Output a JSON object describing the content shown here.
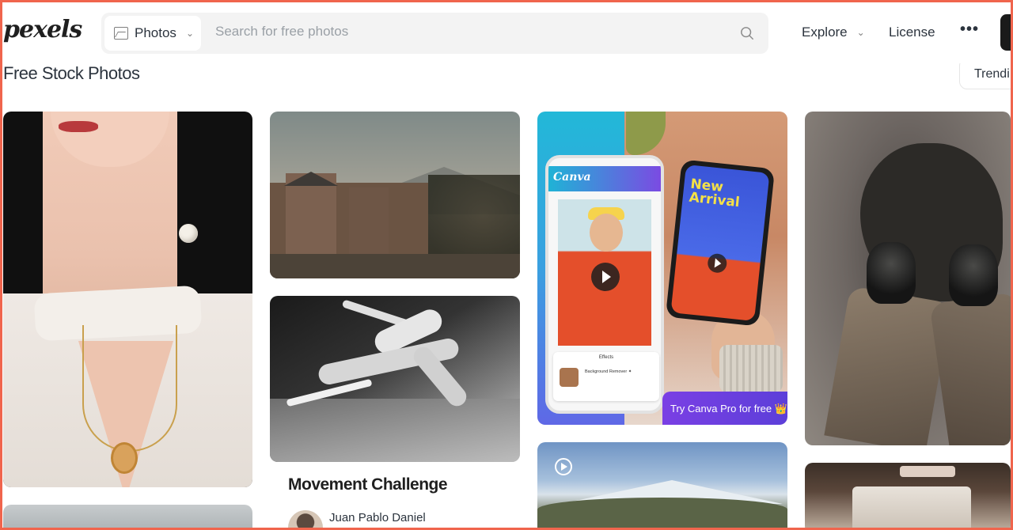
{
  "header": {
    "logo": "pexels",
    "search_type": "Photos",
    "search_placeholder": "Search for free photos",
    "nav_explore": "Explore",
    "nav_license": "License",
    "nav_more": "•••"
  },
  "page": {
    "title": "Free Stock Photos",
    "trending_label": "Trendi"
  },
  "cards": {
    "promo": {
      "app_logo": "Canva",
      "headline": "New Arrival",
      "cta": "Try Canva Pro for free 👑",
      "effects_title": "Effects",
      "effects_item": "Background Remover ✦"
    },
    "collection": {
      "title": "Movement Challenge",
      "author": "Juan Pablo Daniel"
    }
  },
  "colors": {
    "frame": "#f0654d",
    "text": "#2c343e",
    "search_bg": "#f3f3f3"
  },
  "icons": {
    "search_type": "image-icon",
    "search": "search-icon",
    "dropdown": "chevron-down-icon",
    "more": "more-horizontal-icon",
    "video": "play-circle-icon"
  }
}
